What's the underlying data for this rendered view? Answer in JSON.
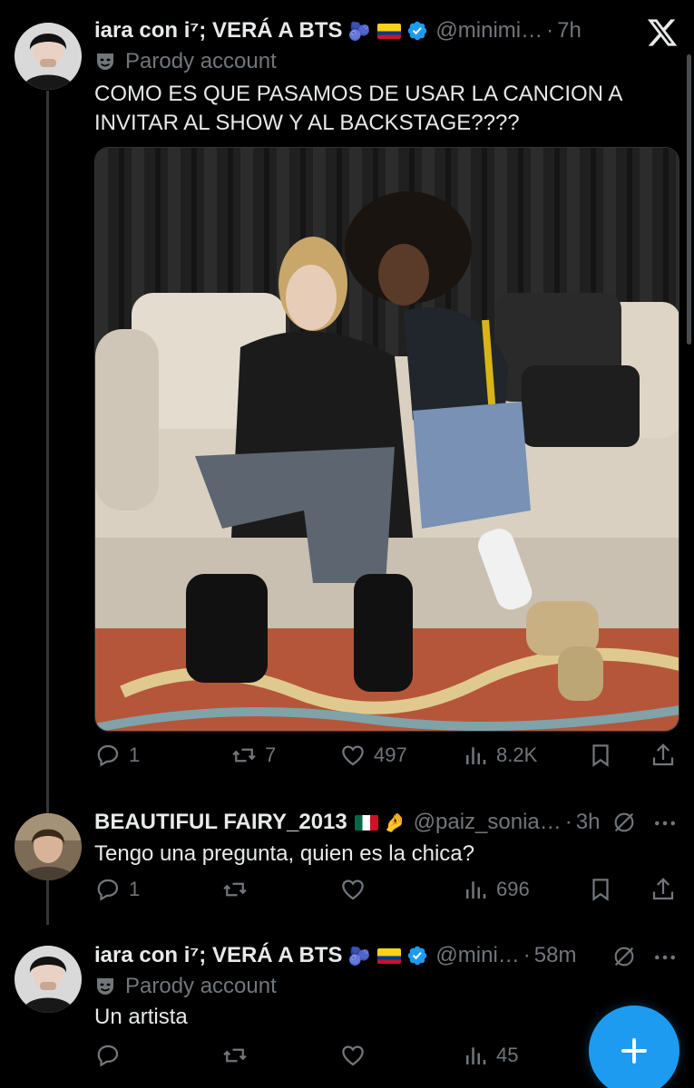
{
  "tweets": [
    {
      "author": "iara con i⁷; VERÁ A BTS",
      "handle": "@minimi…",
      "time": "7h",
      "parody_label": "Parody account",
      "text": "COMO ES QUE PASAMOS DE USAR LA CANCION A INVITAR AL SHOW Y AL BACKSTAGE????",
      "stats": {
        "replies": "1",
        "reposts": "7",
        "likes": "497",
        "views": "8.2K"
      }
    },
    {
      "author": "BEAUTIFUL FAIRY_2013",
      "handle": "@paiz_sonia…",
      "time": "3h",
      "text": "Tengo una pregunta, quien es la chica?",
      "stats": {
        "replies": "1",
        "reposts": "",
        "likes": "",
        "views": "696"
      }
    },
    {
      "author": "iara con i⁷; VERÁ A BTS",
      "handle": "@mini…",
      "time": "58m",
      "parody_label": "Parody account",
      "text": "Un artista",
      "stats": {
        "replies": "",
        "reposts": "",
        "likes": "",
        "views": "45"
      }
    }
  ],
  "separator": "·",
  "icons": [
    "x-logo-icon",
    "verified-badge-icon",
    "parody-mask-icon",
    "reply-icon",
    "repost-icon",
    "like-icon",
    "views-icon",
    "bookmark-icon",
    "share-icon",
    "grok-icon",
    "more-icon",
    "compose-plus-icon"
  ],
  "colors": {
    "background": "#000000",
    "text": "#e7e9ea",
    "muted": "#71767b",
    "accent": "#1d9bf0"
  }
}
